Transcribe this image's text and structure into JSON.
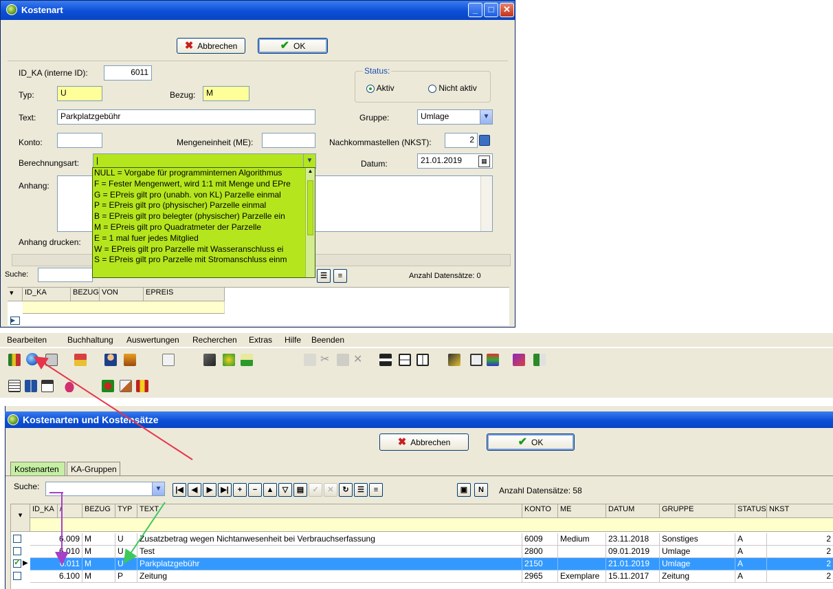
{
  "dialog": {
    "title": "Kostenart",
    "cancel_label": "Abbrechen",
    "ok_label": "OK",
    "id_label": "ID_KA (interne ID):",
    "id_value": "6011",
    "typ_label": "Typ:",
    "typ_value": "U",
    "bezug_label": "Bezug:",
    "bezug_value": "M",
    "status_label": "Status:",
    "status_aktiv": "Aktiv",
    "status_nicht_aktiv": "Nicht aktiv",
    "text_label": "Text:",
    "text_value": "Parkplatzgebühr",
    "gruppe_label": "Gruppe:",
    "gruppe_value": "Umlage",
    "konto_label": "Konto:",
    "konto_value": "",
    "me_label": "Mengeneinheit (ME):",
    "me_value": "",
    "nkst_label": "Nachkommastellen (NKST):",
    "nkst_value": "2",
    "berechnung_label": "Berechnungsart:",
    "berechnung_value": "|",
    "datum_label": "Datum:",
    "datum_value": "21.01.2019",
    "anhang_label": "Anhang:",
    "anhang_drucken_label": "Anhang drucken:",
    "berechnung_options": [
      "NULL  = Vorgabe für programminternen Algorithmus",
      "F = Fester Mengenwert, wird 1:1 mit Menge und EPre",
      "G = EPreis gilt pro (unabh. von KL) Parzelle einmal",
      "P = EPreis gilt pro (physischer) Parzelle einmal",
      "B = EPreis gilt pro belegter (physischer) Parzelle ein",
      "M = EPreis gilt pro Quadratmeter der Parzelle",
      "E = 1 mal fuer jedes Mitglied",
      "W = EPreis gilt pro Parzelle mit Wasseranschluss ei",
      "S = EPreis gilt pro Parzelle mit Stromanschluss einm"
    ],
    "suche_label": "Suche:",
    "anzahl": "Anzahl Datensätze:  0",
    "grid_headers": [
      "ID_KA",
      "BEZUG",
      "VON",
      "EPREIS"
    ]
  },
  "menu": [
    "Bearbeiten",
    "Buchhaltung",
    "Auswertungen",
    "Recherchen",
    "Extras",
    "Hilfe",
    "Beenden"
  ],
  "main": {
    "title": "Kostenarten und Kostensätze",
    "cancel_label": "Abbrechen",
    "ok_label": "OK",
    "tabs": [
      "Kostenarten",
      "KA-Gruppen"
    ],
    "suche_label": "Suche:",
    "anzahl": "Anzahl Datensätze:  58",
    "columns": [
      "ID_KA",
      "/",
      "BEZUG",
      "TYP",
      "TEXT",
      "KONTO",
      "ME",
      "DATUM",
      "GRUPPE",
      "STATUS",
      "NKST"
    ],
    "rows": [
      {
        "id": "6.009",
        "bezug": "M",
        "typ": "U",
        "text": "Zusatzbetrag wegen Nichtanwesenheit bei Verbrauchserfassung",
        "konto": "6009",
        "me": "Medium",
        "datum": "23.11.2018",
        "gruppe": "Sonstiges",
        "status": "A",
        "nkst": "2"
      },
      {
        "id": "6.010",
        "bezug": "M",
        "typ": "U",
        "text": "Test",
        "konto": "2800",
        "me": "",
        "datum": "09.01.2019",
        "gruppe": "Umlage",
        "status": "A",
        "nkst": "2"
      },
      {
        "id": "6.011",
        "bezug": "M",
        "typ": "U",
        "text": "Parkplatzgebühr",
        "konto": "2150",
        "me": "",
        "datum": "21.01.2019",
        "gruppe": "Umlage",
        "status": "A",
        "nkst": "2"
      },
      {
        "id": "6.100",
        "bezug": "M",
        "typ": "P",
        "text": "Zeitung",
        "konto": "2965",
        "me": "Exemplare",
        "datum": "15.11.2017",
        "gruppe": "Zeitung",
        "status": "A",
        "nkst": "2"
      }
    ]
  },
  "colors": {
    "highlight_yellow": "#ffff99",
    "dropdown_green": "#b5e61d",
    "selection_blue": "#3399ff",
    "tab_green": "#c6efa4"
  }
}
